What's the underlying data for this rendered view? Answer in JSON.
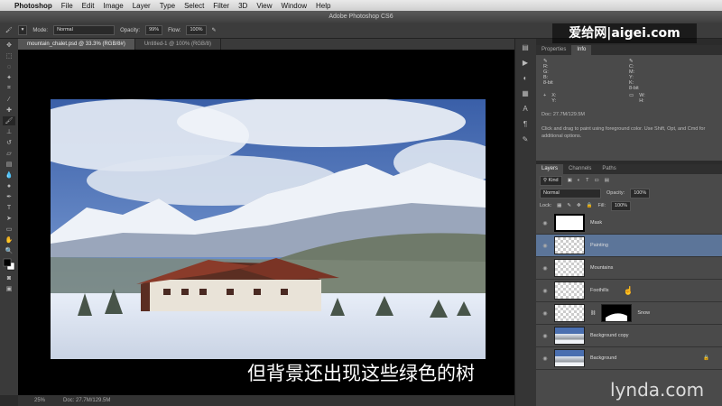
{
  "menubar": {
    "app": "Photoshop",
    "items": [
      "File",
      "Edit",
      "Image",
      "Layer",
      "Type",
      "Select",
      "Filter",
      "3D",
      "View",
      "Window",
      "Help"
    ]
  },
  "window": {
    "title": "Adobe Photoshop CS6"
  },
  "options": {
    "mode_label": "Mode:",
    "mode_value": "Normal",
    "opacity_label": "Opacity:",
    "opacity_value": "99%",
    "flow_label": "Flow:",
    "flow_value": "100%"
  },
  "doc_tabs": [
    {
      "label": "mountain_chalet.psd @ 33.3% (RGB/8#)"
    },
    {
      "label": "Untitled-1 @ 100% (RGB/8)"
    }
  ],
  "status": {
    "zoom": "25%",
    "doc": "Doc: 27.7M/129.5M"
  },
  "info_panel": {
    "tabs": [
      "Properties",
      "Info"
    ],
    "r": "R:",
    "g": "G:",
    "b": "B:",
    "bit1": "8-bit",
    "c": "C:",
    "m": "M:",
    "y": "Y:",
    "k": "K:",
    "bit2": "8-bit",
    "x": "X:",
    "yy": "Y:",
    "w": "W:",
    "h": "H:",
    "doc": "Doc: 27.7M/129.5M",
    "note": "Click and drag to paint using foreground color. Use Shift, Opt, and Cmd for additional options."
  },
  "layers_panel": {
    "tabs": [
      "Layers",
      "Channels",
      "Paths"
    ],
    "kind": "Kind",
    "blend": "Normal",
    "opacity_label": "Opacity:",
    "opacity_value": "100%",
    "lock_label": "Lock:",
    "fill_label": "Fill:",
    "fill_value": "100%",
    "layers": [
      {
        "name": "Mask"
      },
      {
        "name": "Painting",
        "selected": true
      },
      {
        "name": "Mountains"
      },
      {
        "name": "Foothills"
      },
      {
        "name": "Snow"
      },
      {
        "name": "Background copy"
      },
      {
        "name": "Background"
      }
    ]
  },
  "subtitle": "但背景还出现这些绿色的树",
  "watermark_top": "爱给网|aigei.com",
  "watermark_bottom": "lynda.com"
}
